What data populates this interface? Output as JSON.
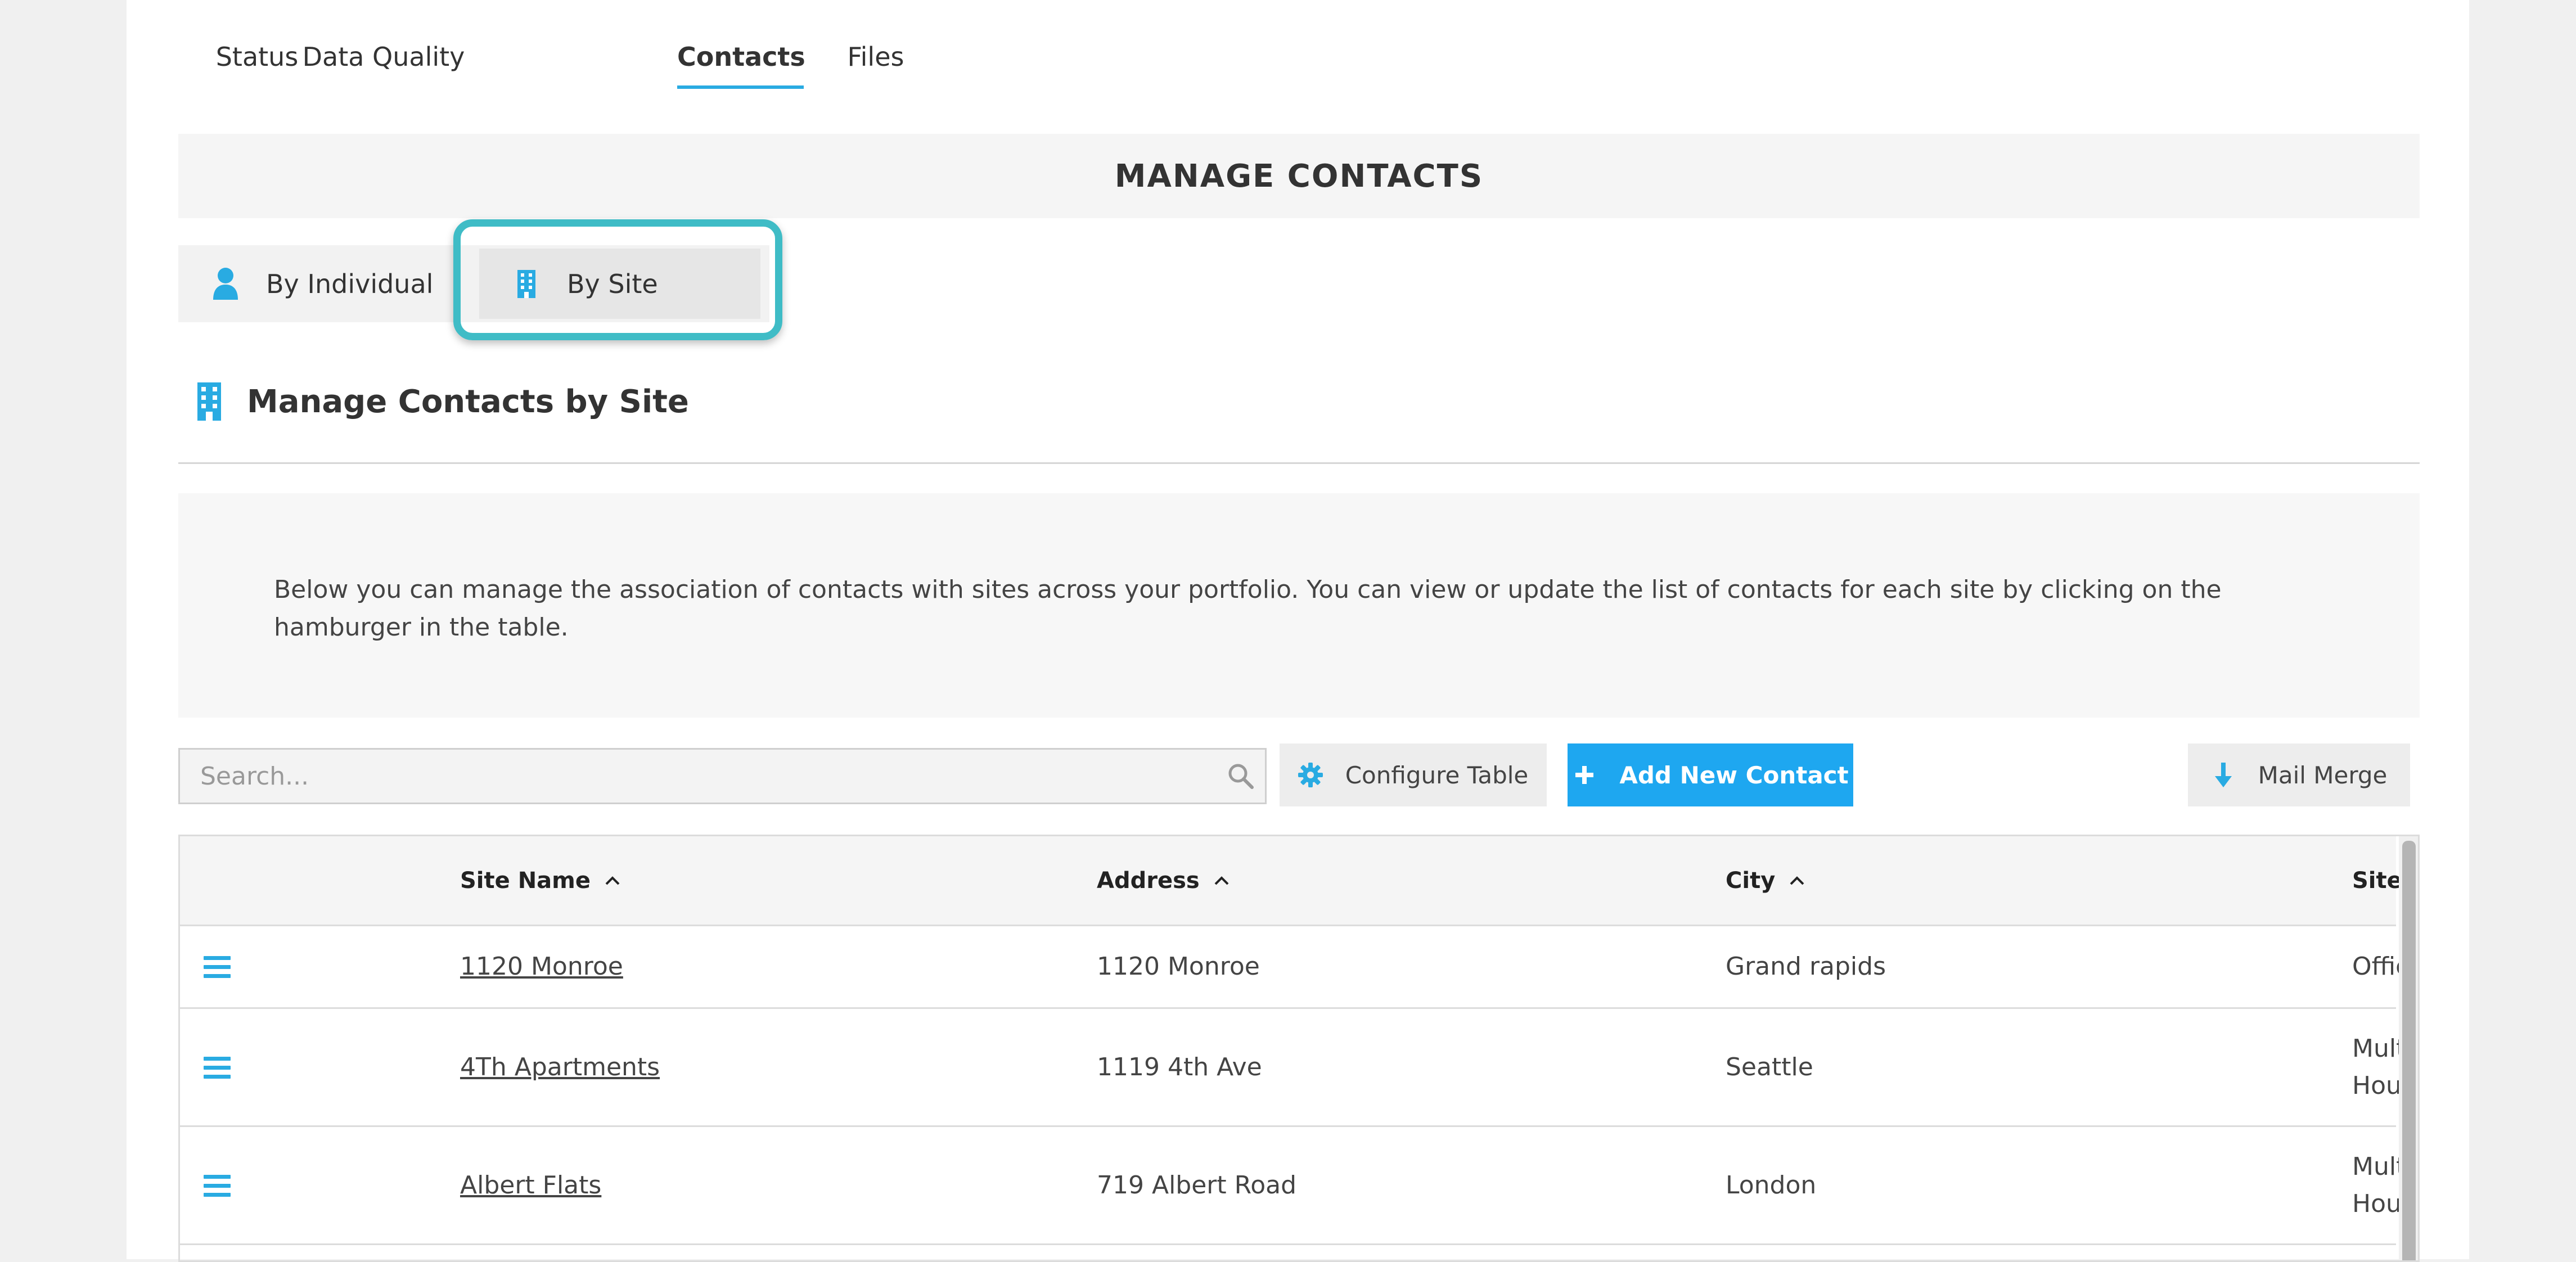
{
  "tabs": [
    {
      "label": "Status",
      "active": false
    },
    {
      "label": "Data Quality",
      "active": false
    },
    {
      "label": "Contacts",
      "active": true
    },
    {
      "label": "Files",
      "active": false
    }
  ],
  "header": {
    "title": "MANAGE CONTACTS"
  },
  "view_toggle": {
    "individual_label": "By Individual",
    "individual_icon": "user-icon",
    "site_label": "By Site",
    "site_icon": "building-icon",
    "selected": "By Site"
  },
  "section": {
    "title": "Manage Contacts by Site",
    "icon": "building-icon"
  },
  "info": {
    "text": "Below you can manage the association of contacts with sites across your portfolio. You can view or update the list of contacts for each site by clicking on the hamburger in the table."
  },
  "toolbar": {
    "search_placeholder": "Search...",
    "search_icon": "search-icon",
    "configure_label": "Configure Table",
    "configure_icon": "gear-icon",
    "add_label": "Add New Contact",
    "add_icon": "plus-icon",
    "merge_label": "Mail Merge",
    "merge_icon": "download-arrow-icon"
  },
  "table": {
    "columns": [
      "Site Name",
      "Address",
      "City",
      "Site Type"
    ],
    "sort_icon": "chevron-up-icon",
    "row_menu_icon": "hamburger-icon",
    "rows": [
      {
        "site_name": "1120 Monroe",
        "address": "1120 Monroe",
        "city": "Grand rapids",
        "site_type": "Office"
      },
      {
        "site_name": "4Th Apartments",
        "address": "1119 4th Ave",
        "city": "Seattle",
        "site_type": "Multifamily Housing"
      },
      {
        "site_name": "Albert Flats",
        "address": "719 Albert Road",
        "city": "London",
        "site_type": "Multifamily Housing"
      }
    ]
  },
  "colors": {
    "accent": "#29abe2",
    "primary_button": "#1ea7f0",
    "highlight": "#3fbcc6"
  }
}
